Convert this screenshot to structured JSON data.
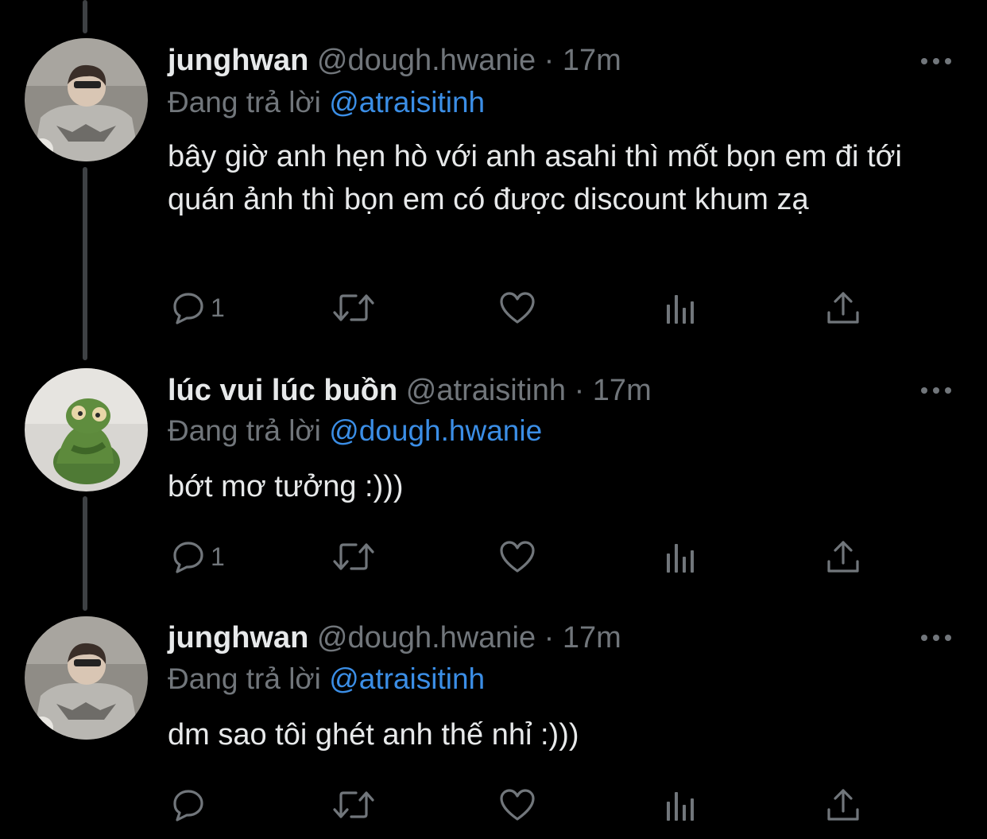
{
  "tweets": [
    {
      "name": "junghwan",
      "handle": "@dough.hwanie",
      "separator": "·",
      "time": "17m",
      "replying_prefix": "Đang trả lời",
      "replying_to": "@atraisitinh",
      "text": "bây giờ anh hẹn hò với anh asahi thì mốt bọn em đi tới quán ảnh thì bọn em có được discount khum zạ",
      "reply_count": "1",
      "avatar": "person-photo"
    },
    {
      "name": "lúc vui lúc buồn",
      "handle": "@atraisitinh",
      "separator": "·",
      "time": "17m",
      "replying_prefix": "Đang trả lời",
      "replying_to": "@dough.hwanie",
      "text": "bớt mơ tưởng :)))",
      "reply_count": "1",
      "avatar": "green-frog-plush"
    },
    {
      "name": "junghwan",
      "handle": "@dough.hwanie",
      "separator": "·",
      "time": "17m",
      "replying_prefix": "Đang trả lời",
      "replying_to": "@atraisitinh",
      "text": "dm sao tôi ghét anh thế nhỉ :)))",
      "reply_count": "",
      "avatar": "person-photo"
    }
  ],
  "icons": {
    "reply": "speech-bubble-icon",
    "retweet": "retweet-icon",
    "like": "heart-icon",
    "views": "bar-chart-icon",
    "share": "share-icon",
    "more": "more-dots-icon"
  },
  "colors": {
    "background": "#000000",
    "text": "#e7e9ea",
    "muted": "#71767b",
    "mention": "#3b8ee6",
    "thread_line": "#3e4144"
  }
}
